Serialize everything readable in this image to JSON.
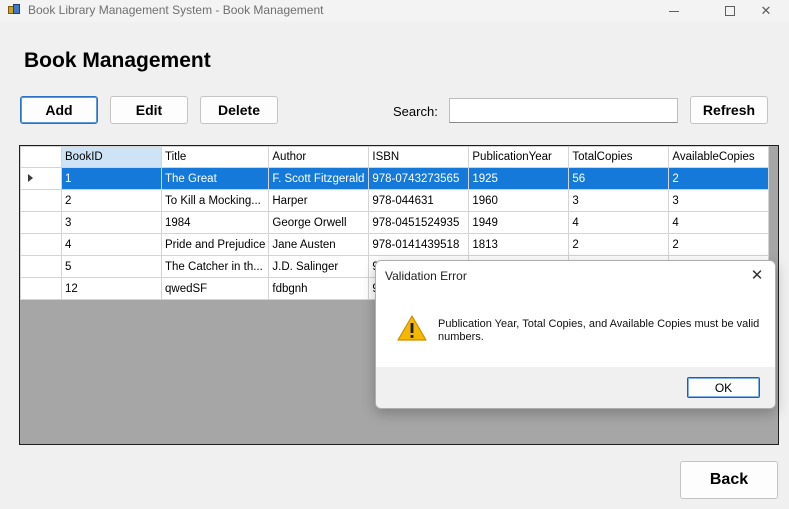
{
  "window": {
    "title": "Book Library Management System - Book Management"
  },
  "page": {
    "title": "Book Management"
  },
  "toolbar": {
    "add": "Add",
    "edit": "Edit",
    "delete": "Delete",
    "search_label": "Search:",
    "search_value": "",
    "refresh": "Refresh"
  },
  "grid": {
    "columns": [
      "BookID",
      "Title",
      "Author",
      "ISBN",
      "PublicationYear",
      "TotalCopies",
      "AvailableCopies"
    ],
    "selected_column": "BookID",
    "selected_row": 0,
    "rows": [
      [
        "1",
        "The Great",
        "F. Scott Fitzgerald",
        "978-0743273565",
        "1925",
        "56",
        "2"
      ],
      [
        "2",
        "To Kill a Mocking...",
        "Harper",
        "978-044631",
        "1960",
        "3",
        "3"
      ],
      [
        "3",
        "1984",
        "George Orwell",
        "978-0451524935",
        "1949",
        "4",
        "4"
      ],
      [
        "4",
        "Pride and Prejudice",
        "Jane Austen",
        "978-0141439518",
        "1813",
        "2",
        "2"
      ],
      [
        "5",
        "The Catcher in th...",
        "J.D. Salinger",
        "97",
        "",
        "",
        ""
      ],
      [
        "12",
        "qwedSF",
        "fdbgnh",
        "98",
        "",
        "",
        ""
      ]
    ]
  },
  "dialog": {
    "title": "Validation Error",
    "message": "Publication Year, Total Copies, and Available Copies must be valid numbers.",
    "ok": "OK",
    "icon": "warning-icon"
  },
  "footer": {
    "back": "Back"
  },
  "colors": {
    "selection": "#1479d9",
    "header_selected": "#cfe3f6",
    "warning": "#f5b700"
  }
}
